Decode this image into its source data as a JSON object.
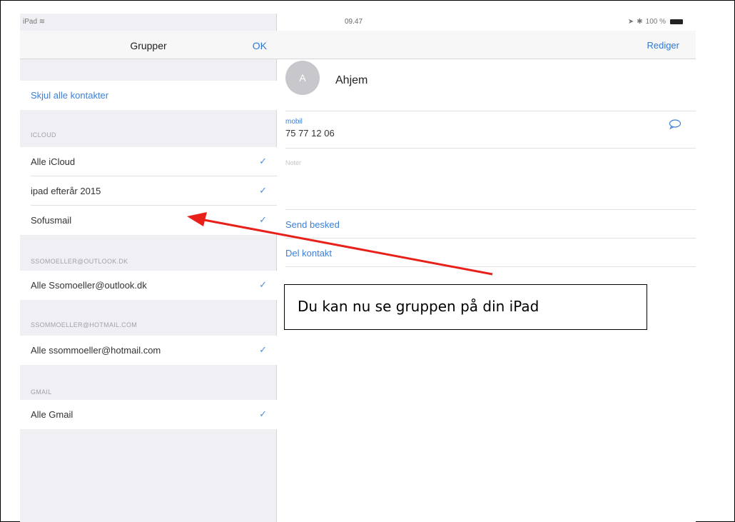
{
  "status_bar": {
    "carrier": "iPad",
    "wifi_icon": "wifi-icon",
    "time": "09.47",
    "battery_percent": "100 %"
  },
  "left_panel": {
    "title": "Grupper",
    "ok_label": "OK",
    "hide_all": "Skjul alle kontakter",
    "sections": [
      {
        "header": "ICLOUD",
        "items": [
          {
            "label": "Alle iCloud",
            "checked": true
          },
          {
            "label": "ipad efterår 2015",
            "checked": true
          },
          {
            "label": "Sofusmail",
            "checked": true
          }
        ]
      },
      {
        "header": "SSOMOELLER@OUTLOOK.DK",
        "items": [
          {
            "label": "Alle Ssomoeller@outlook.dk",
            "checked": true
          }
        ]
      },
      {
        "header": "SSOMMOELLER@HOTMAIL.COM",
        "items": [
          {
            "label": "Alle ssommoeller@hotmail.com",
            "checked": true
          }
        ]
      },
      {
        "header": "GMAIL",
        "items": [
          {
            "label": "Alle Gmail",
            "checked": true
          }
        ]
      }
    ],
    "check_glyph": "✓"
  },
  "right_panel": {
    "edit_label": "Rediger",
    "avatar_initial": "A",
    "contact_name": "Ahjem",
    "phone_label": "mobil",
    "phone_value": "75 77 12 06",
    "notes_label": "Noter",
    "send_message": "Send besked",
    "share_contact": "Del kontakt"
  },
  "annotation": {
    "text": "Du kan nu se gruppen på din iPad",
    "arrow_color": "#e8201a"
  },
  "colors": {
    "accent": "#2d78d6",
    "check": "#4d8fdc",
    "group_bg": "#efeff4",
    "avatar": "#c8c8cc"
  }
}
